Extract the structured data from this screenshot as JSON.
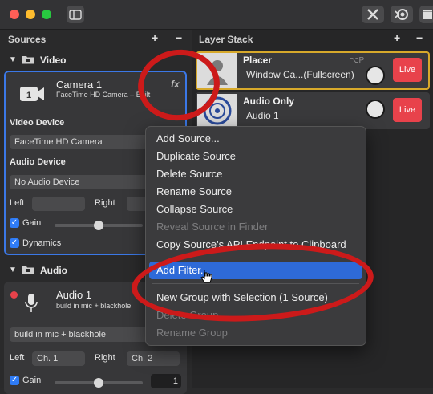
{
  "sources": {
    "title": "Sources",
    "plus": "+",
    "minus": "−",
    "video_group": "Video",
    "audio_group": "Audio"
  },
  "camera": {
    "name": "Camera 1",
    "subtitle": "FaceTime HD Camera – Built",
    "fx": "fx",
    "video_device_label": "Video Device",
    "video_device_value": "FaceTime HD Camera",
    "audio_device_label": "Audio Device",
    "audio_device_value": "No Audio Device",
    "left_label": "Left",
    "right_label": "Right",
    "gain_label": "Gain",
    "dynamics_label": "Dynamics",
    "gain_level": 0.5
  },
  "audio_source": {
    "name": "Audio 1",
    "subtitle": "build in mic + blackhole",
    "device_value": "build in mic + blackhole",
    "left_label": "Left",
    "left_channel": "Ch. 1",
    "right_label": "Right",
    "right_channel": "Ch. 2",
    "gain_label": "Gain",
    "gain_value": "1",
    "gain_level": 0.5
  },
  "layer_stack": {
    "title": "Layer Stack",
    "plus": "+",
    "minus": "−",
    "layers": [
      {
        "name": "Placer",
        "detail": "Window Ca...(Fullscreen)",
        "shortcut": "⌥P",
        "live": "Live"
      },
      {
        "name": "Audio Only",
        "detail": "Audio 1",
        "live": "Live"
      }
    ]
  },
  "context_menu": {
    "items": [
      {
        "label": "Add Source...",
        "enabled": true
      },
      {
        "label": "Duplicate Source",
        "enabled": true
      },
      {
        "label": "Delete Source",
        "enabled": true
      },
      {
        "label": "Rename Source",
        "enabled": true
      },
      {
        "label": "Collapse Source",
        "enabled": true
      },
      {
        "label": "Reveal Source in Finder",
        "enabled": false
      },
      {
        "label": "Copy Source's API Endpoint to Clipboard",
        "enabled": true
      },
      {
        "label": "Add Filter...",
        "enabled": true,
        "highlighted": true
      },
      {
        "label": "New Group with Selection (1 Source)",
        "enabled": true
      },
      {
        "label": "Delete Group",
        "enabled": false
      },
      {
        "label": "Rename Group",
        "enabled": false
      }
    ]
  },
  "colors": {
    "accent": "#2e6ad8",
    "live": "#e8424b",
    "annotation": "#cc1a1a",
    "selection_border": "#3b78e7"
  }
}
